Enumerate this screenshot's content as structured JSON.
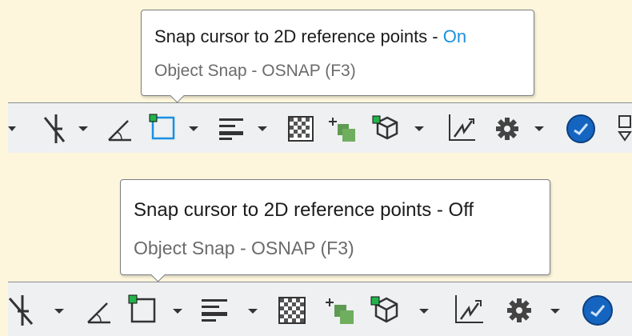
{
  "panels": [
    {
      "tooltip": {
        "title_prefix": "Snap cursor to 2D reference points - ",
        "state": "On",
        "subtitle": "Object Snap - OSNAP (F3)"
      },
      "osnap_active": true
    },
    {
      "tooltip": {
        "title_prefix": "Snap cursor to 2D reference points - ",
        "state": "Off",
        "subtitle": "Object Snap - OSNAP (F3)"
      },
      "osnap_active": false
    }
  ],
  "colors": {
    "accent_on": "#1a90e0",
    "background": "#fdf6dc",
    "toolbar": "#eef0f2",
    "snap_green": "#23b24b"
  },
  "toolbar_icons": [
    "polar-tracking-icon",
    "isometric-drafting-icon",
    "object-snap-icon",
    "lineweight-icon",
    "transparency-icon",
    "selection-cycling-icon",
    "3d-object-snap-icon",
    "dynamic-ucs-icon",
    "customization-gear-icon",
    "hardware-acceleration-icon"
  ]
}
